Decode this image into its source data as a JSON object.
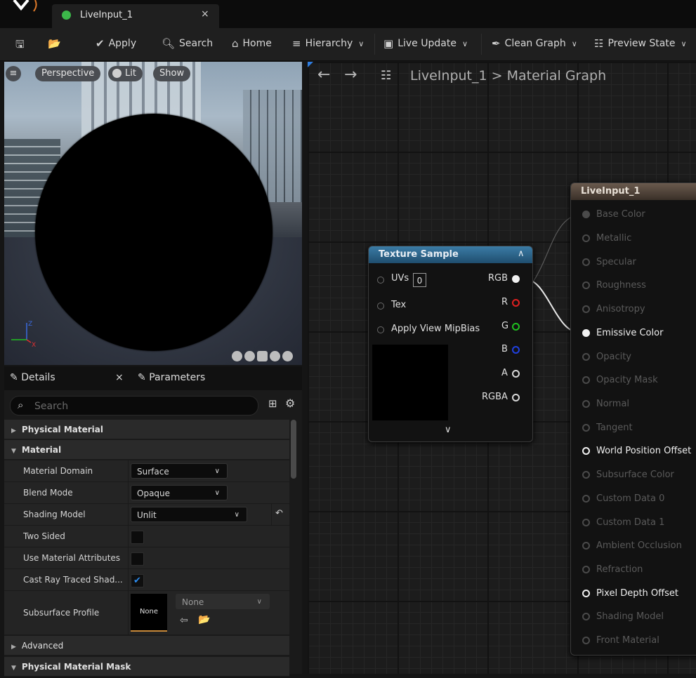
{
  "tab": {
    "title": "LiveInput_1",
    "close": "×"
  },
  "toolbar": {
    "apply": "Apply",
    "search": "Search",
    "home": "Home",
    "hierarchy": "Hierarchy",
    "live_update": "Live Update",
    "clean_graph": "Clean Graph",
    "preview_state": "Preview State"
  },
  "viewport": {
    "perspective": "Perspective",
    "lit": "Lit",
    "show": "Show",
    "axis_z": "Z",
    "axis_x": "X"
  },
  "details": {
    "tab_details": "Details",
    "tab_close": "×",
    "tab_parameters": "Parameters",
    "search_placeholder": "Search",
    "categories": {
      "physical_material": "Physical Material",
      "material": "Material",
      "advanced": "Advanced",
      "physical_material_mask": "Physical Material Mask"
    },
    "props": {
      "material_domain": {
        "label": "Material Domain",
        "value": "Surface"
      },
      "blend_mode": {
        "label": "Blend Mode",
        "value": "Opaque"
      },
      "shading_model": {
        "label": "Shading Model",
        "value": "Unlit"
      },
      "two_sided": {
        "label": "Two Sided",
        "checked": false
      },
      "use_material_attributes": {
        "label": "Use Material Attributes",
        "checked": false
      },
      "cast_ray_traced": {
        "label": "Cast Ray Traced Shad...",
        "checked": true
      },
      "subsurface_profile": {
        "label": "Subsurface Profile",
        "thumb": "None",
        "value": "None"
      }
    }
  },
  "graph": {
    "breadcrumb_asset": "LiveInput_1",
    "breadcrumb_sep": ">",
    "breadcrumb_graph": "Material Graph"
  },
  "texture_sample": {
    "title": "Texture Sample",
    "inputs": {
      "uvs": "UVs",
      "uvs_value": "0",
      "tex": "Tex",
      "mip": "Apply View MipBias"
    },
    "outputs": {
      "rgb": "RGB",
      "r": "R",
      "g": "G",
      "b": "B",
      "a": "A",
      "rgba": "RGBA"
    },
    "colors": {
      "r": "#e02020",
      "g": "#20c020",
      "b": "#2040e0",
      "white": "#f0f0f0"
    }
  },
  "result_node": {
    "title": "LiveInput_1",
    "pins": [
      "Base Color",
      "Metallic",
      "Specular",
      "Roughness",
      "Anisotropy",
      "Emissive Color",
      "Opacity",
      "Opacity Mask",
      "Normal",
      "Tangent",
      "World Position Offset",
      "Subsurface Color",
      "Custom Data 0",
      "Custom Data 1",
      "Ambient Occlusion",
      "Refraction",
      "Pixel Depth Offset",
      "Shading Model",
      "Front Material"
    ]
  }
}
